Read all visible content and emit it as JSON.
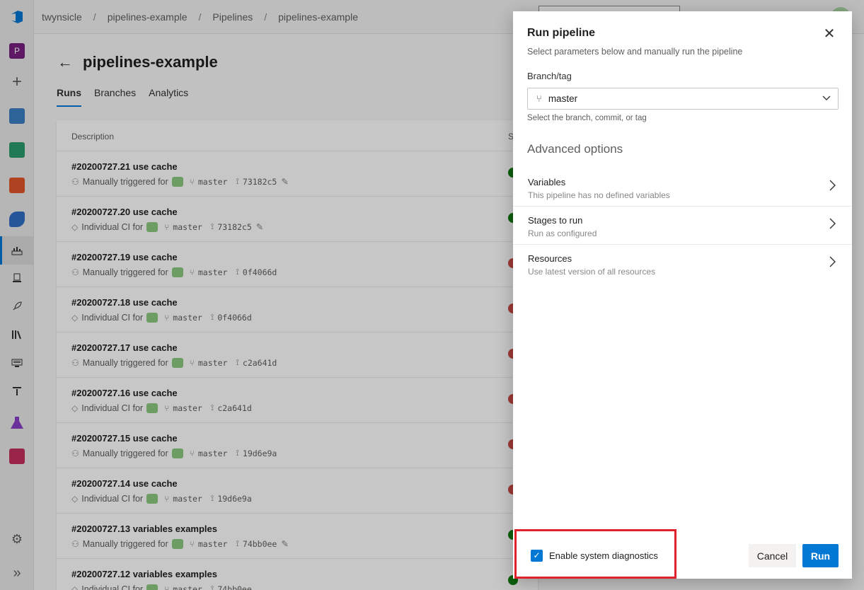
{
  "breadcrumb": [
    "twynsicle",
    "pipelines-example",
    "Pipelines",
    "pipelines-example"
  ],
  "rail": {
    "project_initial": "P",
    "add_glyph": "+",
    "settings_glyph": "⚙",
    "expand_glyph": "»",
    "icons": [
      "azure-devops-logo-icon",
      "project-avatar-icon",
      "add-icon",
      "overview-icon",
      "boards-icon",
      "repos-icon",
      "pipelines-icon",
      "pipelines-sub-icon",
      "environments-icon",
      "releases-icon",
      "library-icon",
      "task-groups-icon",
      "deployment-groups-icon",
      "test-plans-icon",
      "artifacts-icon",
      "project-settings-icon",
      "collapse-icon"
    ]
  },
  "page": {
    "title": "pipelines-example",
    "tabs": [
      "Runs",
      "Branches",
      "Analytics"
    ],
    "column_description": "Description",
    "column_status_partial": "S"
  },
  "runs": [
    {
      "title": "#20200727.21 use cache",
      "trigger": "Manually triggered for",
      "branch": "master",
      "commit": "73182c5",
      "pinned": true,
      "status": "success"
    },
    {
      "title": "#20200727.20 use cache",
      "trigger": "Individual CI for",
      "branch": "master",
      "commit": "73182c5",
      "pinned": true,
      "status": "success"
    },
    {
      "title": "#20200727.19 use cache",
      "trigger": "Manually triggered for",
      "branch": "master",
      "commit": "0f4066d",
      "pinned": false,
      "status": "failed"
    },
    {
      "title": "#20200727.18 use cache",
      "trigger": "Individual CI for",
      "branch": "master",
      "commit": "0f4066d",
      "pinned": false,
      "status": "failed"
    },
    {
      "title": "#20200727.17 use cache",
      "trigger": "Manually triggered for",
      "branch": "master",
      "commit": "c2a641d",
      "pinned": false,
      "status": "failed"
    },
    {
      "title": "#20200727.16 use cache",
      "trigger": "Individual CI for",
      "branch": "master",
      "commit": "c2a641d",
      "pinned": false,
      "status": "failed"
    },
    {
      "title": "#20200727.15 use cache",
      "trigger": "Manually triggered for",
      "branch": "master",
      "commit": "19d6e9a",
      "pinned": false,
      "status": "failed"
    },
    {
      "title": "#20200727.14 use cache",
      "trigger": "Individual CI for",
      "branch": "master",
      "commit": "19d6e9a",
      "pinned": false,
      "status": "failed"
    },
    {
      "title": "#20200727.13 variables examples",
      "trigger": "Manually triggered for",
      "branch": "master",
      "commit": "74bb0ee",
      "pinned": true,
      "status": "success"
    },
    {
      "title": "#20200727.12 variables examples",
      "trigger": "Individual CI for",
      "branch": "master",
      "commit": "74bb0ee",
      "pinned": false,
      "status": "success"
    }
  ],
  "panel": {
    "title": "Run pipeline",
    "subtitle": "Select parameters below and manually run the pipeline",
    "branch_label": "Branch/tag",
    "branch_value": "master",
    "branch_help": "Select the branch, commit, or tag",
    "advanced_heading": "Advanced options",
    "options": [
      {
        "title": "Variables",
        "desc": "This pipeline has no defined variables"
      },
      {
        "title": "Stages to run",
        "desc": "Run as configured"
      },
      {
        "title": "Resources",
        "desc": "Use latest version of all resources"
      }
    ],
    "diagnostics_label": "Enable system diagnostics",
    "diagnostics_checked": true,
    "cancel_label": "Cancel",
    "run_label": "Run"
  },
  "colors": {
    "accent": "#0078d4",
    "success": "#107c10",
    "failed": "#cd4a45",
    "highlight": "#e0202a"
  }
}
